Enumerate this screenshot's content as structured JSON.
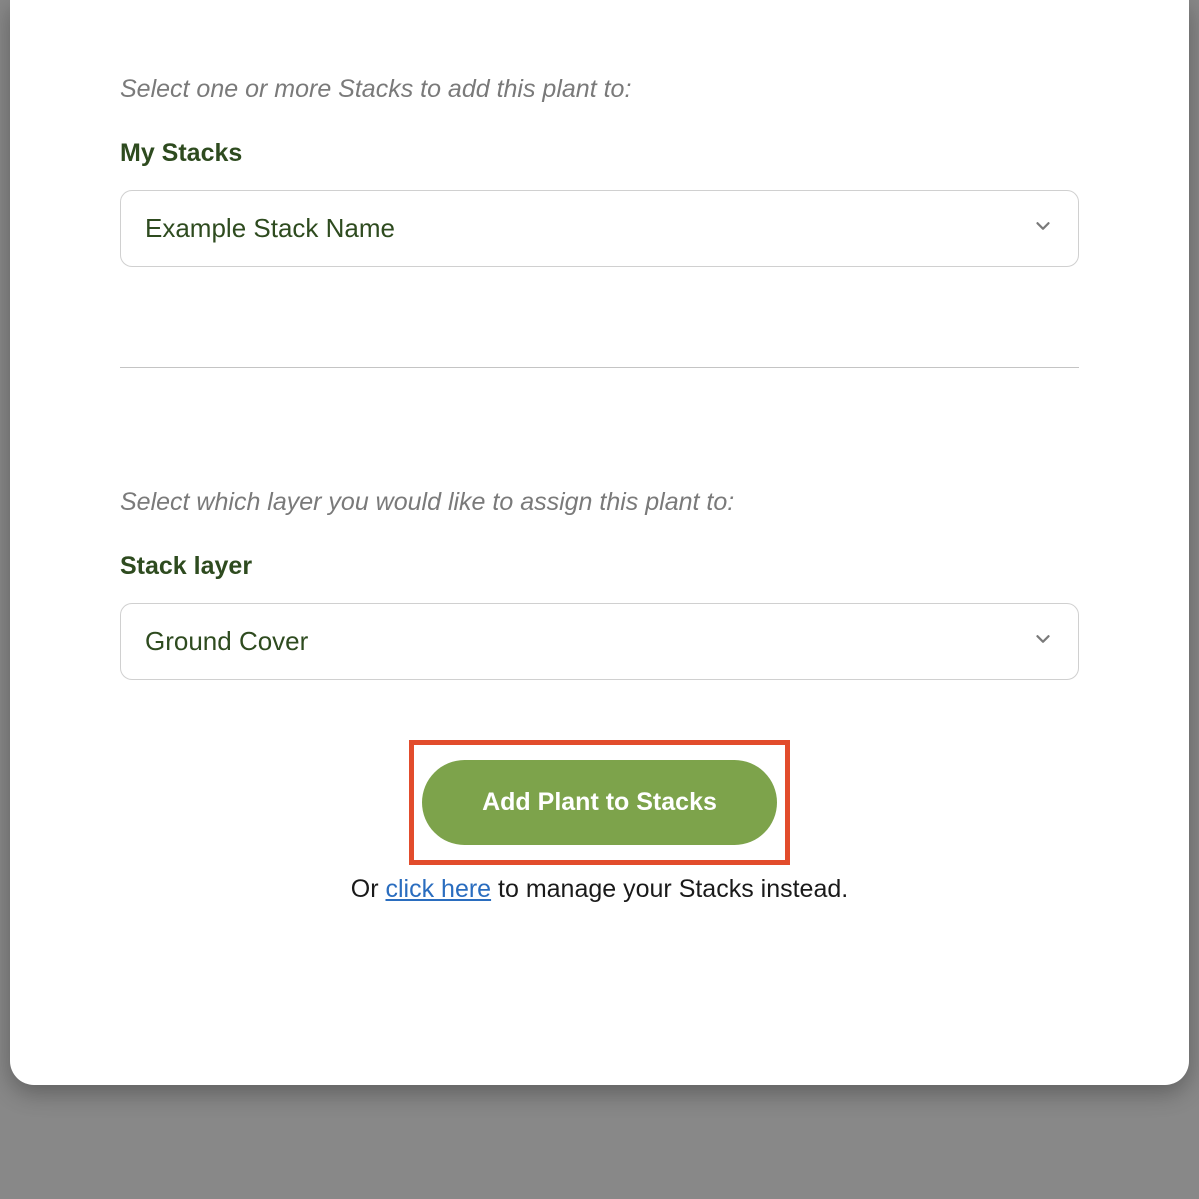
{
  "stacksSection": {
    "instruction": "Select one or more Stacks to add this plant to:",
    "label": "My Stacks",
    "selectedValue": "Example Stack Name"
  },
  "layerSection": {
    "instruction": "Select which layer you would like to assign this plant to:",
    "label": "Stack layer",
    "selectedValue": "Ground Cover"
  },
  "actions": {
    "primaryButtonLabel": "Add Plant to Stacks",
    "secondaryPrefix": "Or ",
    "secondaryLink": "click here",
    "secondarySuffix": " to manage your Stacks instead."
  }
}
